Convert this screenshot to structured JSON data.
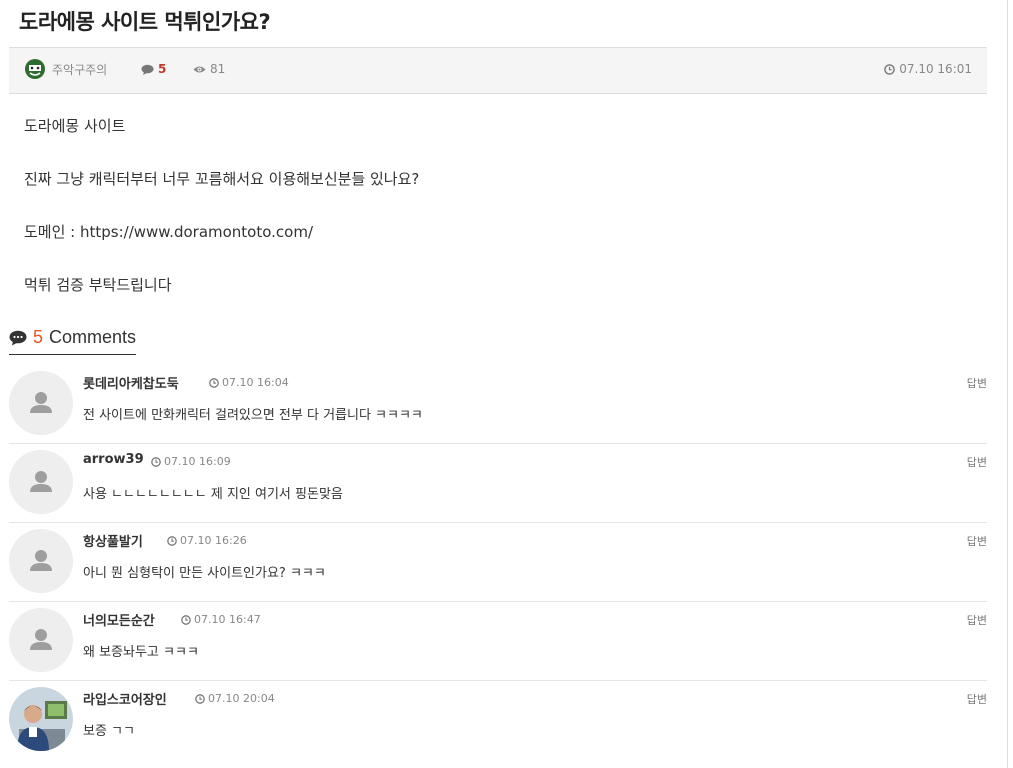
{
  "post": {
    "title": "도라에몽 사이트 먹튀인가요?",
    "author": "주악구주의",
    "comment_count": "5",
    "views": "81",
    "date": "07.10 16:01",
    "body": [
      "도라에몽 사이트",
      "진짜 그냥 캐릭터부터 너무 꼬름해서요 이용해보신분들 있나요?",
      "도메인 : https://www.doramontoto.com/",
      "먹튀 검증 부탁드립니다"
    ]
  },
  "comments_section": {
    "count": "5",
    "label": "Comments"
  },
  "comments": [
    {
      "name": "롯데리아케찹도둑",
      "date": "07.10 16:04",
      "text": "전 사이트에 만화캐릭터 걸려있으면 전부 다 거릅니다 ㅋㅋㅋㅋ",
      "reply": "답변"
    },
    {
      "name": "arrow39",
      "date": "07.10 16:09",
      "text": "사용 ㄴㄴㄴㄴㄴㄴㄴㄴ 제 지인 여기서 핑돈맞음",
      "reply": "답변"
    },
    {
      "name": "항상풀발기",
      "date": "07.10 16:26",
      "text": "아니 뭔 심형탁이 만든 사이트인가요? ㅋㅋㅋ",
      "reply": "답변"
    },
    {
      "name": "너의모든순간",
      "date": "07.10 16:47",
      "text": "왜 보증놔두고 ㅋㅋㅋ",
      "reply": "답변"
    },
    {
      "name": "라입스코어장인",
      "date": "07.10 20:04",
      "text": "보증 ㄱㄱ",
      "reply": "답변"
    }
  ],
  "icons": {
    "author": "smiley-avatar-icon",
    "comments": "chat-bubble-icon",
    "views": "eye-icon",
    "date": "clock-icon",
    "default_avatar": "user-silhouette-icon",
    "photo_avatar": "user-photo"
  },
  "colors": {
    "comment_count": "#c0392b",
    "comments_heading_count": "#e8541e",
    "meta_bar_bg": "#f5f5f5"
  }
}
